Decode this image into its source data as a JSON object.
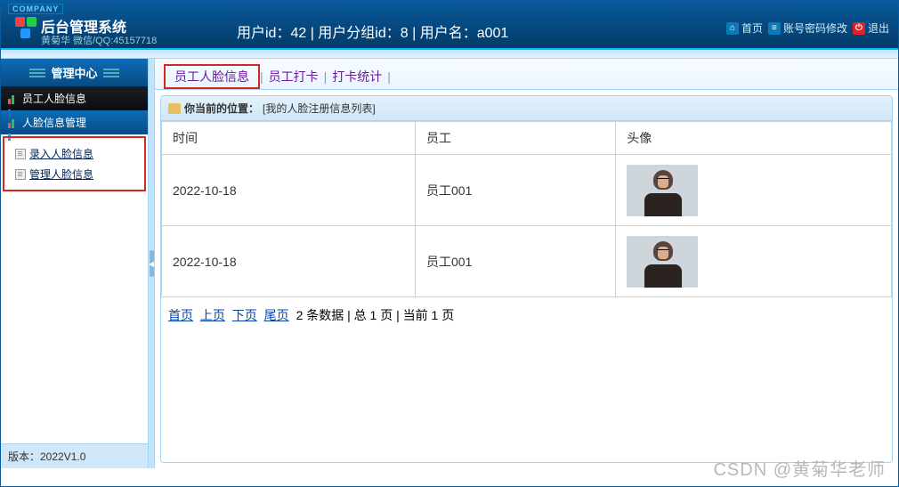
{
  "brand": {
    "tag": "COMPANY",
    "title": "后台管理系统",
    "sub": "黄菊华 微信/QQ:45157718"
  },
  "userinfo": "用户id：42 | 用户分组id：8 | 用户名：a001",
  "top_actions": {
    "home": "首页",
    "pwd": "账号密码修改",
    "logout": "退出"
  },
  "sidebar": {
    "header": "管理中心",
    "group": "员工人脸信息",
    "sub": "人脸信息管理",
    "links": {
      "add": "录入人脸信息",
      "manage": "管理人脸信息"
    },
    "version": "版本：2022V1.0"
  },
  "tabs": {
    "t1": "员工人脸信息",
    "t2": "员工打卡",
    "t3": "打卡统计",
    "sep": "|"
  },
  "breadcrumb": {
    "label": "你当前的位置：",
    "value": "[我的人脸注册信息列表]"
  },
  "table": {
    "headers": {
      "time": "时间",
      "emp": "员工",
      "avatar": "头像"
    },
    "rows": [
      {
        "time": "2022-10-18",
        "emp": "员工001"
      },
      {
        "time": "2022-10-18",
        "emp": "员工001"
      }
    ]
  },
  "pager": {
    "first": "首页",
    "prev": "上页",
    "next": "下页",
    "last": "尾页",
    "info": "2 条数据 | 总 1 页 | 当前 1 页"
  },
  "watermark": "CSDN @黄菊华老师"
}
